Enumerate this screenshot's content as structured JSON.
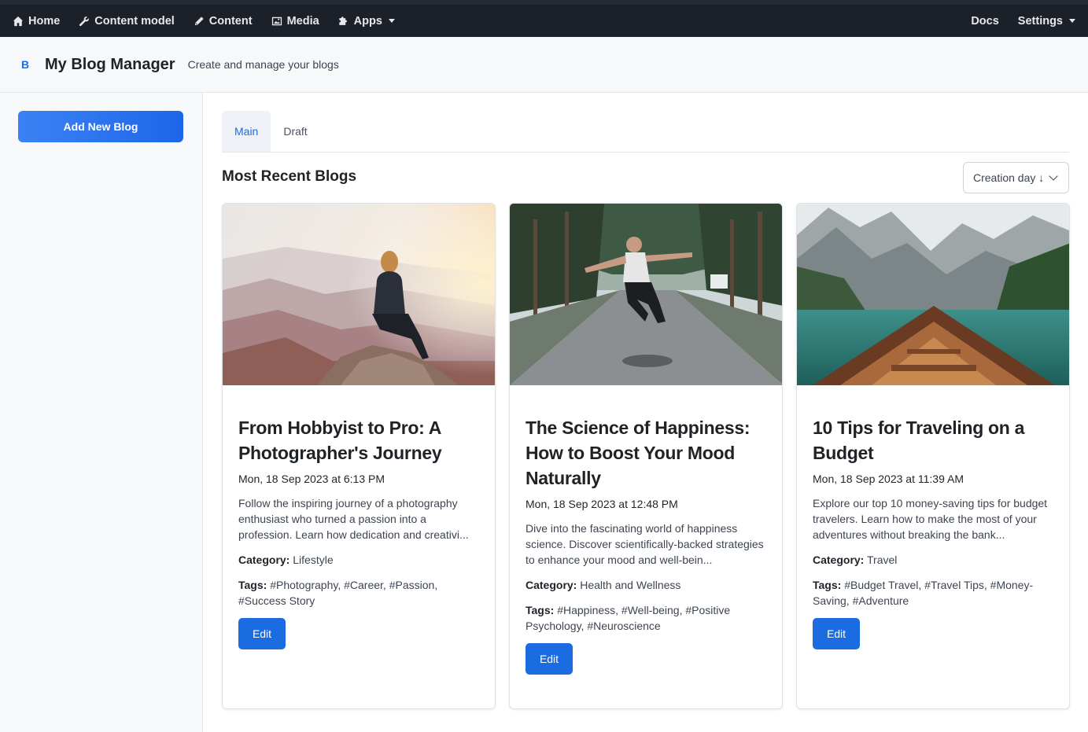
{
  "nav": {
    "left": [
      {
        "label": "Home",
        "icon": "home-icon"
      },
      {
        "label": "Content model",
        "icon": "wrench-icon"
      },
      {
        "label": "Content",
        "icon": "pen-icon"
      },
      {
        "label": "Media",
        "icon": "image-icon"
      },
      {
        "label": "Apps",
        "icon": "puzzle-icon"
      }
    ],
    "right": [
      {
        "label": "Docs"
      },
      {
        "label": "Settings"
      }
    ]
  },
  "header": {
    "logo": "B",
    "title": "My Blog Manager",
    "subtitle": "Create and manage your blogs"
  },
  "sidebar": {
    "add_button": "Add New Blog"
  },
  "tabs": [
    {
      "label": "Main",
      "active": true
    },
    {
      "label": "Draft",
      "active": false
    }
  ],
  "section": {
    "title": "Most Recent Blogs",
    "sort_label": "Creation day ↓"
  },
  "labels": {
    "category": "Category:",
    "tags": "Tags:",
    "edit": "Edit"
  },
  "cards": [
    {
      "title": "From Hobbyist to Pro: A Photographer's Journey",
      "date": "Mon, 18 Sep 2023 at 6:13 PM",
      "description": "Follow the inspiring journey of a photography enthusiast who turned a passion into a profession. Learn how dedication and creativi...",
      "category": "Lifestyle",
      "tags": "#Photography, #Career, #Passion, #Success Story"
    },
    {
      "title": "The Science of Happiness: How to Boost Your Mood Naturally",
      "date": "Mon, 18 Sep 2023 at 12:48 PM",
      "description": "Dive into the fascinating world of happiness science. Discover scientifically-backed strategies to enhance your mood and well-bein...",
      "category": "Health and Wellness",
      "tags": "#Happiness, #Well-being, #Positive Psychology, #Neuroscience"
    },
    {
      "title": "10 Tips for Traveling on a Budget",
      "date": "Mon, 18 Sep 2023 at 11:39 AM",
      "description": "Explore our top 10 money-saving tips for budget travelers. Learn how to make the most of your adventures without breaking the bank...",
      "category": "Travel",
      "tags": "#Budget Travel, #Travel Tips, #Money-Saving, #Adventure"
    }
  ]
}
